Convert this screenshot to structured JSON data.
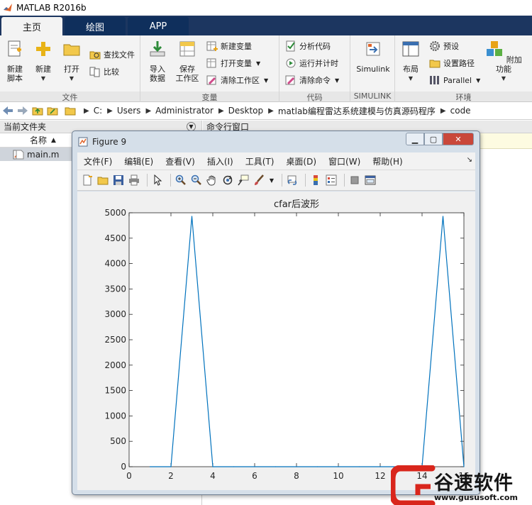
{
  "app": {
    "title": "MATLAB R2016b"
  },
  "tabs": [
    {
      "label": "主页",
      "active": true
    },
    {
      "label": "绘图",
      "active": false
    },
    {
      "label": "APP",
      "active": false
    }
  ],
  "ribbon": {
    "groups": [
      {
        "title": "文件"
      },
      {
        "title": "变量"
      },
      {
        "title": "代码"
      },
      {
        "title": "SIMULINK"
      },
      {
        "title": "环境"
      }
    ],
    "buttons": {
      "new_script": [
        "新建",
        "脚本"
      ],
      "new": "新建",
      "open": "打开",
      "find_files": "查找文件",
      "compare": "比较",
      "import_data": [
        "导入",
        "数据"
      ],
      "save_workspace": [
        "保存",
        "工作区"
      ],
      "new_variable": "新建变量",
      "open_variable": "打开变量",
      "clear_workspace": "清除工作区",
      "analyze_code": "分析代码",
      "run_and_time": "运行并计时",
      "clear_commands": "清除命令",
      "simulink": "Simulink",
      "layout": "布局",
      "preferences": "预设",
      "set_path": "设置路径",
      "parallel": "Parallel",
      "addons": "附加功能"
    }
  },
  "address": {
    "crumbs": [
      "C:",
      "Users",
      "Administrator",
      "Desktop",
      "matlab编程雷达系统建模与仿真源码程序",
      "code"
    ]
  },
  "current_folder": {
    "header": "当前文件夹",
    "column_name": "名称",
    "sort_indicator": "▲",
    "files": [
      {
        "name": "main.m"
      }
    ]
  },
  "command_window": {
    "header": "命令行窗口"
  },
  "figure": {
    "title": "Figure 9",
    "menu": [
      "文件(F)",
      "编辑(E)",
      "查看(V)",
      "插入(I)",
      "工具(T)",
      "桌面(D)",
      "窗口(W)",
      "帮助(H)"
    ],
    "colors": {
      "line": "#0072bd",
      "titlebar": "#d5dfe9",
      "close": "#c9473a"
    }
  },
  "chart_data": {
    "type": "line",
    "title": "cfar后波形",
    "xlabel": "",
    "ylabel": "",
    "xlim": [
      0,
      16
    ],
    "ylim": [
      0,
      5000
    ],
    "xticks": [
      0,
      2,
      4,
      6,
      8,
      10,
      12,
      14,
      16
    ],
    "yticks": [
      0,
      500,
      1000,
      1500,
      2000,
      2500,
      3000,
      3500,
      4000,
      4500,
      5000
    ],
    "grid": false,
    "series": [
      {
        "color": "#0072bd",
        "x": [
          1,
          2,
          3,
          4,
          5,
          6,
          7,
          8,
          9,
          10,
          11,
          12,
          13,
          14,
          15,
          16
        ],
        "y": [
          0,
          0,
          4930,
          0,
          0,
          0,
          0,
          0,
          0,
          0,
          0,
          0,
          0,
          0,
          4930,
          0
        ]
      }
    ]
  },
  "watermark": {
    "brand": "谷速软件",
    "url": "www.gususoft.com",
    "color": "#d9261c"
  }
}
